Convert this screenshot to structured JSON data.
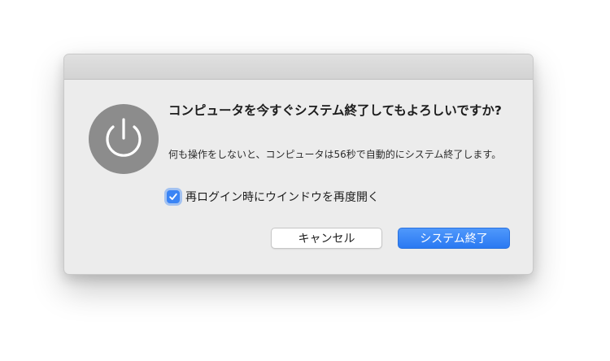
{
  "dialog": {
    "heading": "コンピュータを今すぐシステム終了してもよろしいですか?",
    "message": "何も操作をしないと、コンピュータは56秒で自動的にシステム終了します。",
    "reopen_checkbox": {
      "label": "再ログイン時にウインドウを再度開く",
      "checked": true
    },
    "buttons": {
      "cancel_label": "キャンセル",
      "shutdown_label": "システム終了"
    },
    "icon": "power-icon"
  },
  "colors": {
    "accent": "#2a79f2",
    "icon_gray": "#8c8c8c"
  }
}
